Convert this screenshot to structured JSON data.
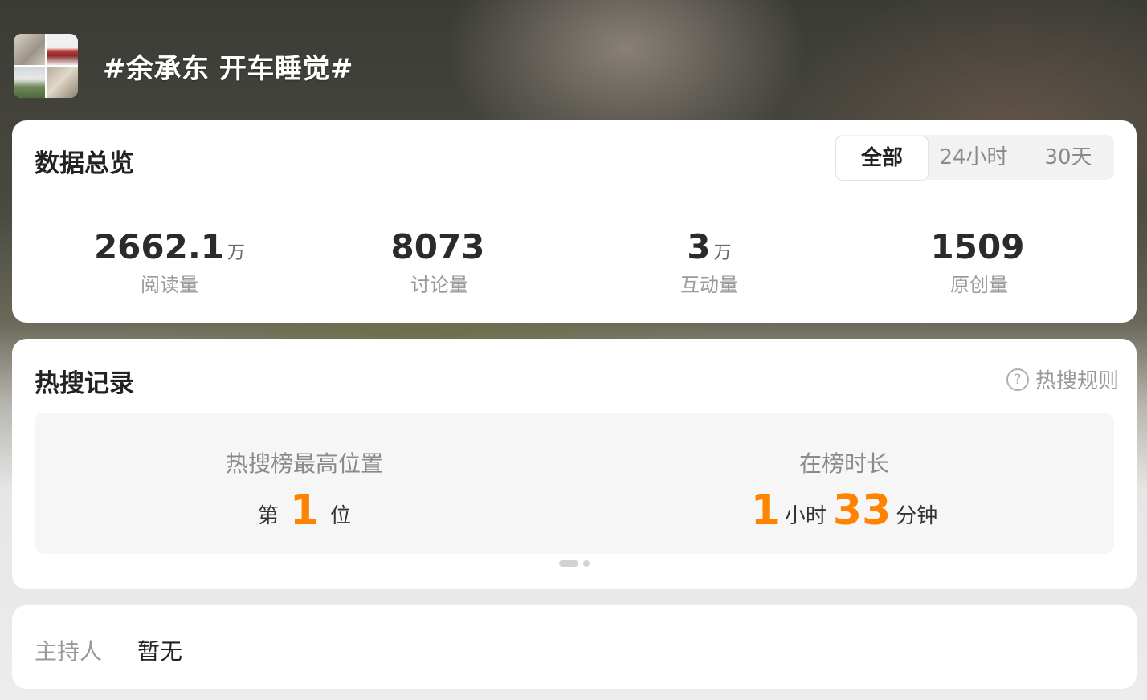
{
  "header": {
    "topic_title": "#余承东 开车睡觉#"
  },
  "overview": {
    "title": "数据总览",
    "tabs": [
      {
        "label": "全部",
        "active": true
      },
      {
        "label": "24小时",
        "active": false
      },
      {
        "label": "30天",
        "active": false
      }
    ],
    "stats": [
      {
        "value": "2662.1",
        "unit": "万",
        "label": "阅读量"
      },
      {
        "value": "8073",
        "unit": "",
        "label": "讨论量"
      },
      {
        "value": "3",
        "unit": "万",
        "label": "互动量"
      },
      {
        "value": "1509",
        "unit": "",
        "label": "原创量"
      }
    ]
  },
  "hot_search": {
    "title": "热搜记录",
    "rule_label": "热搜规则",
    "rule_icon": "question-circle-icon",
    "peak": {
      "label": "热搜榜最高位置",
      "prefix": "第",
      "value": "1",
      "suffix": "位"
    },
    "duration": {
      "label": "在榜时长",
      "hours": "1",
      "hours_unit": "小时",
      "minutes": "33",
      "minutes_unit": "分钟"
    },
    "pagination": {
      "pages": 2,
      "current": 1
    }
  },
  "host": {
    "label": "主持人",
    "value": "暂无"
  },
  "colors": {
    "accent": "#ff8200",
    "card_bg": "#ffffff",
    "muted_text": "#999999"
  }
}
